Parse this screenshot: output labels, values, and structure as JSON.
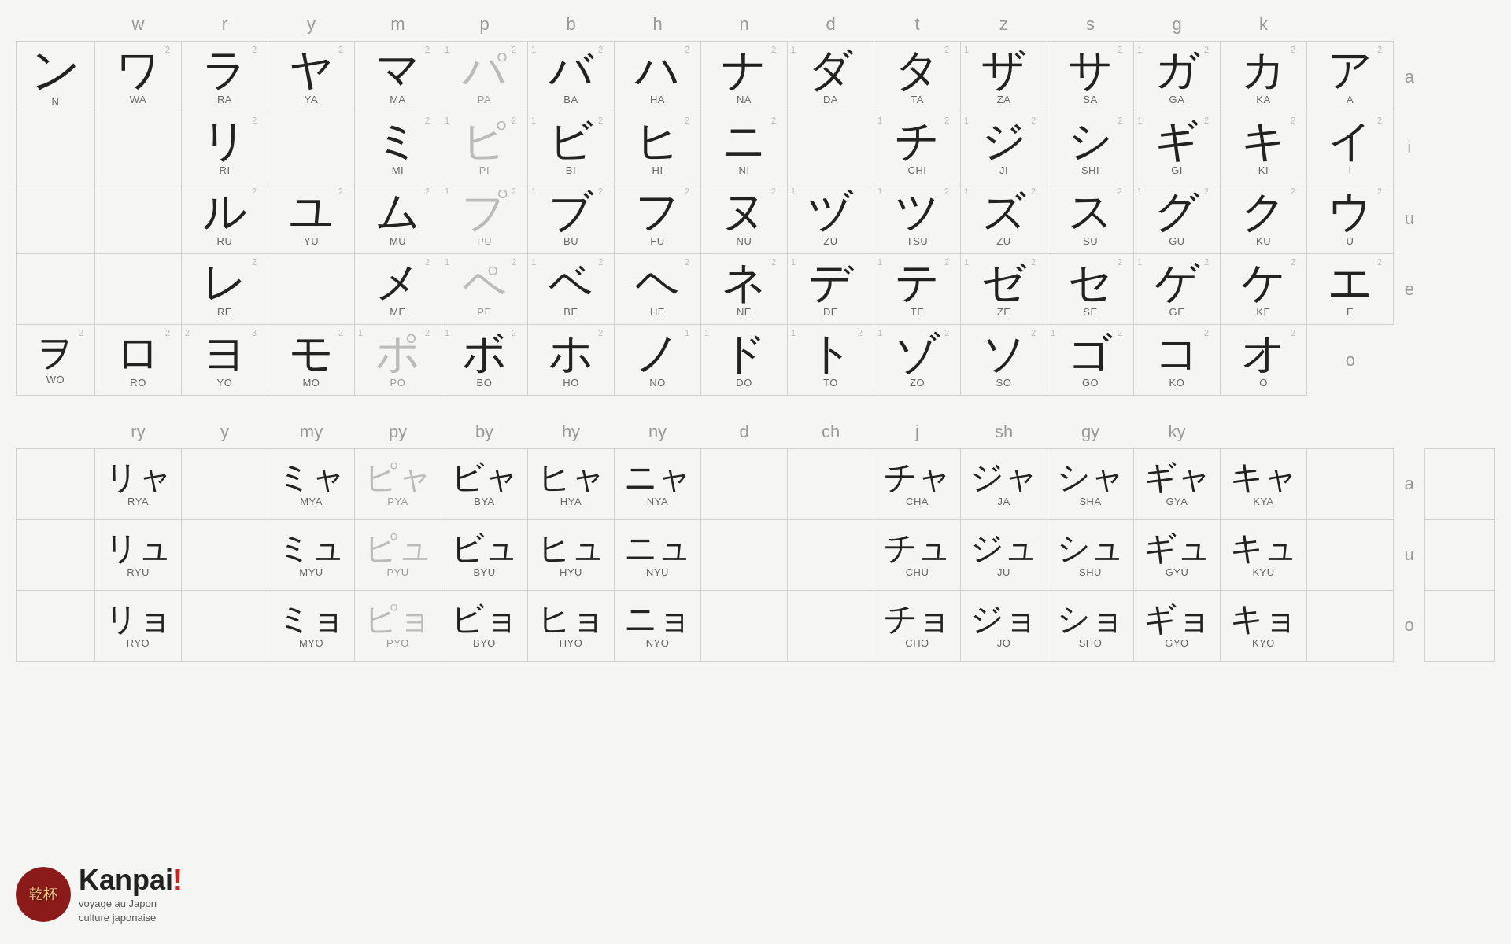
{
  "colors": {
    "dark": "#222",
    "light": "#bbb",
    "header": "#999",
    "label": "#888",
    "accent": "#cc2222"
  },
  "main_headers": [
    "w",
    "r",
    "y",
    "m",
    "p",
    "b",
    "h",
    "n",
    "d",
    "t",
    "z",
    "s",
    "g",
    "k",
    ""
  ],
  "row_headers": [
    "a",
    "i",
    "u",
    "e",
    "o"
  ],
  "combo_headers": [
    "ry",
    "y",
    "my",
    "py",
    "by",
    "hy",
    "ny",
    "",
    "d",
    "ch",
    "j",
    "sh",
    "gy",
    "ky"
  ],
  "combo_row_headers": [
    "a",
    "u",
    "o"
  ],
  "logo": {
    "kanji": "乾杯",
    "brand": "Kanpai",
    "exclaim": "!",
    "sub1": "voyage au Japon",
    "sub2": "culture japonaise"
  },
  "main_rows": [
    {
      "row": "a",
      "cells": [
        {
          "char": "ン",
          "label": "N",
          "style": "dark",
          "col": "n_special"
        },
        {
          "char": "ワ",
          "label": "WA",
          "style": "dark",
          "col": "w"
        },
        {
          "char": "ラ",
          "label": "RA",
          "style": "dark",
          "col": "r"
        },
        {
          "char": "ヤ",
          "label": "YA",
          "style": "dark",
          "col": "y"
        },
        {
          "char": "マ",
          "label": "MA",
          "style": "dark",
          "col": "m"
        },
        {
          "char": "パ",
          "label": "PA",
          "style": "light",
          "col": "p"
        },
        {
          "char": "バ",
          "label": "BA",
          "style": "dark",
          "col": "b"
        },
        {
          "char": "ハ",
          "label": "HA",
          "style": "dark",
          "col": "h"
        },
        {
          "char": "ナ",
          "label": "NA",
          "style": "dark",
          "col": "n"
        },
        {
          "char": "ダ",
          "label": "DA",
          "style": "dark",
          "col": "d"
        },
        {
          "char": "タ",
          "label": "TA",
          "style": "dark",
          "col": "t"
        },
        {
          "char": "ザ",
          "label": "ZA",
          "style": "dark",
          "col": "z"
        },
        {
          "char": "サ",
          "label": "SA",
          "style": "dark",
          "col": "s"
        },
        {
          "char": "ガ",
          "label": "GA",
          "style": "dark",
          "col": "g"
        },
        {
          "char": "カ",
          "label": "KA",
          "style": "dark",
          "col": "k"
        },
        {
          "char": "ア",
          "label": "A",
          "style": "dark",
          "col": "vowel"
        }
      ]
    },
    {
      "row": "i",
      "cells": [
        {
          "char": "",
          "label": "",
          "style": "empty",
          "col": "n_special"
        },
        {
          "char": "",
          "label": "",
          "style": "empty",
          "col": "w"
        },
        {
          "char": "リ",
          "label": "RI",
          "style": "dark",
          "col": "r"
        },
        {
          "char": "",
          "label": "",
          "style": "empty",
          "col": "y"
        },
        {
          "char": "ミ",
          "label": "MI",
          "style": "dark",
          "col": "m"
        },
        {
          "char": "ピ",
          "label": "PI",
          "style": "light",
          "col": "p"
        },
        {
          "char": "ビ",
          "label": "BI",
          "style": "dark",
          "col": "b"
        },
        {
          "char": "ヒ",
          "label": "HI",
          "style": "dark",
          "col": "h"
        },
        {
          "char": "ニ",
          "label": "NI",
          "style": "dark",
          "col": "n"
        },
        {
          "char": "",
          "label": "",
          "style": "empty",
          "col": "d"
        },
        {
          "char": "チ",
          "label": "CHI",
          "style": "dark",
          "col": "t"
        },
        {
          "char": "ジ",
          "label": "JI",
          "style": "dark",
          "col": "z"
        },
        {
          "char": "シ",
          "label": "SHI",
          "style": "dark",
          "col": "s"
        },
        {
          "char": "ギ",
          "label": "GI",
          "style": "dark",
          "col": "g"
        },
        {
          "char": "キ",
          "label": "KI",
          "style": "dark",
          "col": "k"
        },
        {
          "char": "イ",
          "label": "I",
          "style": "dark",
          "col": "vowel"
        }
      ]
    },
    {
      "row": "u",
      "cells": [
        {
          "char": "",
          "label": "",
          "style": "empty",
          "col": "n_special"
        },
        {
          "char": "",
          "label": "",
          "style": "empty",
          "col": "w"
        },
        {
          "char": "ル",
          "label": "RU",
          "style": "dark",
          "col": "r"
        },
        {
          "char": "ユ",
          "label": "YU",
          "style": "dark",
          "col": "y"
        },
        {
          "char": "ム",
          "label": "MU",
          "style": "dark",
          "col": "m"
        },
        {
          "char": "プ",
          "label": "PU",
          "style": "light",
          "col": "p"
        },
        {
          "char": "ブ",
          "label": "BU",
          "style": "dark",
          "col": "b"
        },
        {
          "char": "フ",
          "label": "FU",
          "style": "dark",
          "col": "h"
        },
        {
          "char": "ヌ",
          "label": "NU",
          "style": "dark",
          "col": "n"
        },
        {
          "char": "ヅ",
          "label": "ZU",
          "style": "dark",
          "col": "d"
        },
        {
          "char": "ツ",
          "label": "TSU",
          "style": "dark",
          "col": "t"
        },
        {
          "char": "ズ",
          "label": "ZU",
          "style": "dark",
          "col": "z"
        },
        {
          "char": "ス",
          "label": "SU",
          "style": "dark",
          "col": "s"
        },
        {
          "char": "グ",
          "label": "GU",
          "style": "dark",
          "col": "g"
        },
        {
          "char": "ク",
          "label": "KU",
          "style": "dark",
          "col": "k"
        },
        {
          "char": "ウ",
          "label": "U",
          "style": "dark",
          "col": "vowel"
        }
      ]
    },
    {
      "row": "e",
      "cells": [
        {
          "char": "",
          "label": "",
          "style": "empty",
          "col": "n_special"
        },
        {
          "char": "",
          "label": "",
          "style": "empty",
          "col": "w"
        },
        {
          "char": "レ",
          "label": "RE",
          "style": "dark",
          "col": "r"
        },
        {
          "char": "",
          "label": "",
          "style": "empty",
          "col": "y"
        },
        {
          "char": "メ",
          "label": "ME",
          "style": "dark",
          "col": "m"
        },
        {
          "char": "ペ",
          "label": "PE",
          "style": "light",
          "col": "p"
        },
        {
          "char": "ベ",
          "label": "BE",
          "style": "dark",
          "col": "b"
        },
        {
          "char": "ヘ",
          "label": "HE",
          "style": "dark",
          "col": "h"
        },
        {
          "char": "ネ",
          "label": "NE",
          "style": "dark",
          "col": "n"
        },
        {
          "char": "デ",
          "label": "DE",
          "style": "dark",
          "col": "d"
        },
        {
          "char": "テ",
          "label": "TE",
          "style": "dark",
          "col": "t"
        },
        {
          "char": "ゼ",
          "label": "ZE",
          "style": "dark",
          "col": "z"
        },
        {
          "char": "セ",
          "label": "SE",
          "style": "dark",
          "col": "s"
        },
        {
          "char": "ゲ",
          "label": "GE",
          "style": "dark",
          "col": "g"
        },
        {
          "char": "ケ",
          "label": "KE",
          "style": "dark",
          "col": "k"
        },
        {
          "char": "エ",
          "label": "E",
          "style": "dark",
          "col": "vowel"
        }
      ]
    },
    {
      "row": "o",
      "cells": [
        {
          "char": "ヲ",
          "label": "WO",
          "style": "dark",
          "col": "n_special"
        },
        {
          "char": "ロ",
          "label": "RO",
          "style": "dark",
          "col": "w"
        },
        {
          "char": "ヨ",
          "label": "YO",
          "style": "dark",
          "col": "r"
        },
        {
          "char": "モ",
          "label": "MO",
          "style": "dark",
          "col": "y"
        },
        {
          "char": "ポ",
          "label": "PO",
          "style": "light",
          "col": "m"
        },
        {
          "char": "ボ",
          "label": "BO",
          "style": "dark",
          "col": "p"
        },
        {
          "char": "ホ",
          "label": "HO",
          "style": "dark",
          "col": "b"
        },
        {
          "char": "ノ",
          "label": "NO",
          "style": "dark",
          "col": "h"
        },
        {
          "char": "ド",
          "label": "DO",
          "style": "dark",
          "col": "n"
        },
        {
          "char": "ト",
          "label": "TO",
          "style": "dark",
          "col": "d"
        },
        {
          "char": "ゾ",
          "label": "ZO",
          "style": "dark",
          "col": "t"
        },
        {
          "char": "ソ",
          "label": "SO",
          "style": "dark",
          "col": "z"
        },
        {
          "char": "ゴ",
          "label": "GO",
          "style": "dark",
          "col": "s"
        },
        {
          "char": "コ",
          "label": "KO",
          "style": "dark",
          "col": "g"
        },
        {
          "char": "オ",
          "label": "O",
          "style": "dark",
          "col": "k"
        }
      ]
    }
  ],
  "combo_rows": [
    {
      "row": "a",
      "cells": [
        {
          "char": "リャ",
          "label": "RYA",
          "style": "dark"
        },
        {
          "char": "",
          "label": "",
          "style": "empty"
        },
        {
          "char": "ミャ",
          "label": "MYA",
          "style": "dark"
        },
        {
          "char": "ピャ",
          "label": "PYA",
          "style": "light"
        },
        {
          "char": "ビャ",
          "label": "BYA",
          "style": "dark"
        },
        {
          "char": "ヒャ",
          "label": "HYA",
          "style": "dark"
        },
        {
          "char": "ニャ",
          "label": "NYA",
          "style": "dark"
        },
        {
          "char": "",
          "label": "",
          "style": "empty"
        },
        {
          "char": "",
          "label": "",
          "style": "empty"
        },
        {
          "char": "チャ",
          "label": "CHA",
          "style": "dark"
        },
        {
          "char": "ジャ",
          "label": "JA",
          "style": "dark"
        },
        {
          "char": "シャ",
          "label": "SHA",
          "style": "dark"
        },
        {
          "char": "ギャ",
          "label": "GYA",
          "style": "dark"
        },
        {
          "char": "キャ",
          "label": "KYA",
          "style": "dark"
        }
      ]
    },
    {
      "row": "u",
      "cells": [
        {
          "char": "リュ",
          "label": "RYU",
          "style": "dark"
        },
        {
          "char": "",
          "label": "",
          "style": "empty"
        },
        {
          "char": "ミュ",
          "label": "MYU",
          "style": "dark"
        },
        {
          "char": "ピュ",
          "label": "PYU",
          "style": "light"
        },
        {
          "char": "ビュ",
          "label": "BYU",
          "style": "dark"
        },
        {
          "char": "ヒュ",
          "label": "HYU",
          "style": "dark"
        },
        {
          "char": "ニュ",
          "label": "NYU",
          "style": "dark"
        },
        {
          "char": "",
          "label": "",
          "style": "empty"
        },
        {
          "char": "",
          "label": "",
          "style": "empty"
        },
        {
          "char": "チュ",
          "label": "CHU",
          "style": "dark"
        },
        {
          "char": "ジュ",
          "label": "JU",
          "style": "dark"
        },
        {
          "char": "シュ",
          "label": "SHU",
          "style": "dark"
        },
        {
          "char": "ギュ",
          "label": "GYU",
          "style": "dark"
        },
        {
          "char": "キュ",
          "label": "KYU",
          "style": "dark"
        }
      ]
    },
    {
      "row": "o",
      "cells": [
        {
          "char": "リョ",
          "label": "RYO",
          "style": "dark"
        },
        {
          "char": "",
          "label": "",
          "style": "empty"
        },
        {
          "char": "ミョ",
          "label": "MYO",
          "style": "dark"
        },
        {
          "char": "ピョ",
          "label": "PYO",
          "style": "light"
        },
        {
          "char": "ビョ",
          "label": "BYO",
          "style": "dark"
        },
        {
          "char": "ヒョ",
          "label": "HYO",
          "style": "dark"
        },
        {
          "char": "ニョ",
          "label": "NYO",
          "style": "dark"
        },
        {
          "char": "",
          "label": "",
          "style": "empty"
        },
        {
          "char": "",
          "label": "",
          "style": "empty"
        },
        {
          "char": "チョ",
          "label": "CHO",
          "style": "dark"
        },
        {
          "char": "ジョ",
          "label": "JO",
          "style": "dark"
        },
        {
          "char": "ショ",
          "label": "SHO",
          "style": "dark"
        },
        {
          "char": "ギョ",
          "label": "GYO",
          "style": "dark"
        },
        {
          "char": "キョ",
          "label": "KYO",
          "style": "dark"
        }
      ]
    }
  ]
}
